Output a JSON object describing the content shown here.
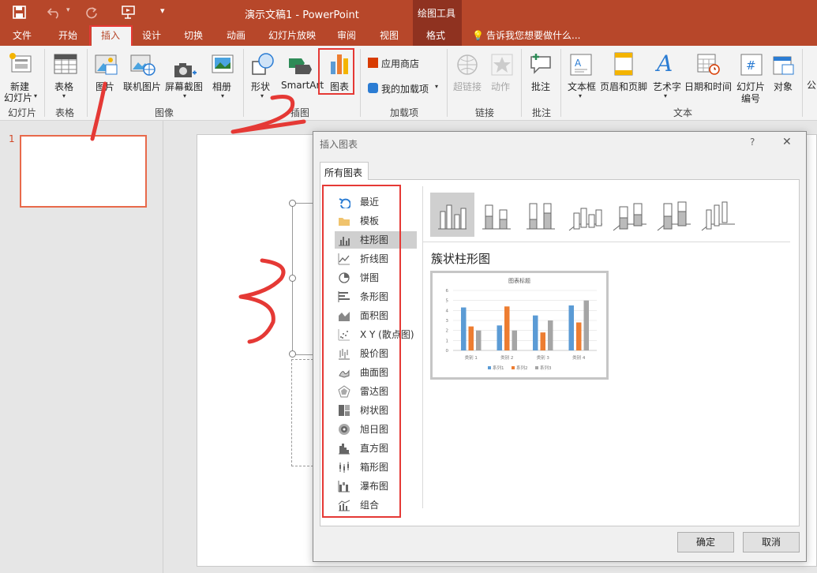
{
  "window": {
    "title": "演示文稿1 - PowerPoint",
    "tools_context": "绘图工具"
  },
  "qat": {
    "save": "save-icon",
    "undo": "undo-icon",
    "redo": "redo-icon",
    "present": "present-icon",
    "customize": "▾"
  },
  "tabs": [
    "文件",
    "开始",
    "插入",
    "设计",
    "切换",
    "动画",
    "幻灯片放映",
    "审阅",
    "视图",
    "格式"
  ],
  "tell_me": "告诉我您想要做什么...",
  "ribbon": {
    "new_slide": [
      "新建",
      "幻灯片"
    ],
    "table": "表格",
    "picture": "图片",
    "online_picture": "联机图片",
    "screenshot": "屏幕截图",
    "album": "相册",
    "shapes": "形状",
    "smartart": "SmartArt",
    "chart": "图表",
    "store": "应用商店",
    "my_addins": "我的加载项",
    "hyperlink": "超链接",
    "action": "动作",
    "comment": "批注",
    "textbox": "文本框",
    "header_footer": "页眉和页脚",
    "wordart": "艺术字",
    "datetime": "日期和时间",
    "slide_number": [
      "幻灯片",
      "编号"
    ],
    "object": "对象",
    "cut_label": "公",
    "groups": {
      "slides": "幻灯片",
      "tables": "表格",
      "images": "图像",
      "illustrations": "插图",
      "addins": "加载项",
      "links": "链接",
      "comments": "批注",
      "text": "文本"
    }
  },
  "thumb": {
    "number": "1"
  },
  "dialog": {
    "title": "插入图表",
    "help": "?",
    "close": "✕",
    "tab": "所有图表",
    "chart_types": [
      "最近",
      "模板",
      "柱形图",
      "折线图",
      "饼图",
      "条形图",
      "面积图",
      "X Y (散点图)",
      "股价图",
      "曲面图",
      "雷达图",
      "树状图",
      "旭日图",
      "直方图",
      "箱形图",
      "瀑布图",
      "组合"
    ],
    "selected_type": "柱形图",
    "subtype_title": "簇状柱形图",
    "ok": "确定",
    "cancel": "取消"
  },
  "annotations": [
    "1",
    "2",
    "3"
  ],
  "colors": {
    "brand": "#b7472a",
    "s1": "#5b9bd5",
    "s2": "#ed7d31",
    "s3": "#a5a5a5",
    "annot": "#e53935"
  },
  "chart_data": {
    "type": "bar",
    "title": "图表标题",
    "categories": [
      "类别 1",
      "类别 2",
      "类别 3",
      "类别 4"
    ],
    "series": [
      {
        "name": "系列1",
        "values": [
          4.3,
          2.5,
          3.5,
          4.5
        ]
      },
      {
        "name": "系列2",
        "values": [
          2.4,
          4.4,
          1.8,
          2.8
        ]
      },
      {
        "name": "系列3",
        "values": [
          2,
          2,
          3,
          5
        ]
      }
    ],
    "yticks": [
      "0",
      "1",
      "2",
      "3",
      "4",
      "5",
      "6"
    ],
    "ylim": [
      0,
      6
    ],
    "grid": true,
    "legend": "bottom"
  }
}
